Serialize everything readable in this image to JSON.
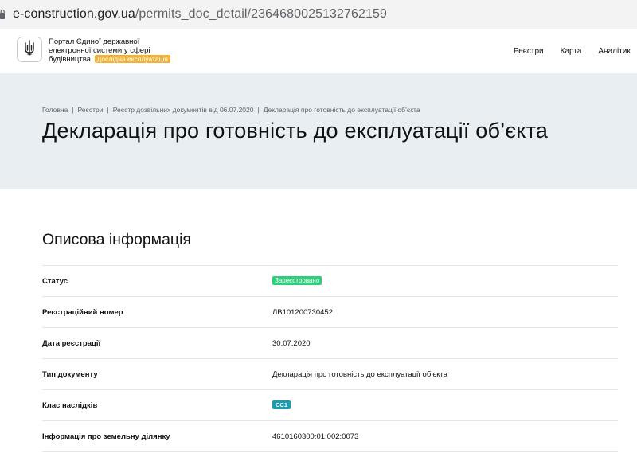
{
  "browser": {
    "url_host": "e-construction.gov.ua",
    "url_path": "/permits_doc_detail/2364680025132762159"
  },
  "header": {
    "portal_name": "Портал Єдиної державної електронної системи у сфері будівництва",
    "beta_badge": "Дослідна експлуатація",
    "nav": [
      "Реєстри",
      "Карта",
      "Аналітик"
    ]
  },
  "hero": {
    "breadcrumb": [
      "Головна",
      "Реєстри",
      "Реєстр дозвільних документів від 06.07.2020",
      "Декларація про готовність до експлуатації об’єкта"
    ],
    "title": "Декларація про готовність до експлуатації об’єкта"
  },
  "section": {
    "title": "Описова інформація",
    "rows": [
      {
        "label": "Статус",
        "value": "Зареєстровано",
        "status_color": "#2ecf7a"
      },
      {
        "label": "Реєстраційний номер",
        "value": "ЛВ101200730452"
      },
      {
        "label": "Дата реєстрації",
        "value": "30.07.2020"
      },
      {
        "label": "Тип документу",
        "value": "Декларація про готовність до експлуатації об’єкта"
      },
      {
        "label": "Клас наслідків",
        "value": "СС1",
        "badge_color": "#1b9bb0"
      },
      {
        "label": "Інформація про земельну ділянку",
        "value": "4610160300:01:002:0073"
      }
    ]
  },
  "colors": {
    "hero_bg": "#e8eef2",
    "beta_badge": "#f2b233"
  },
  "icons": {
    "lock": "lock-icon",
    "logo": "trident-emblem-icon"
  }
}
